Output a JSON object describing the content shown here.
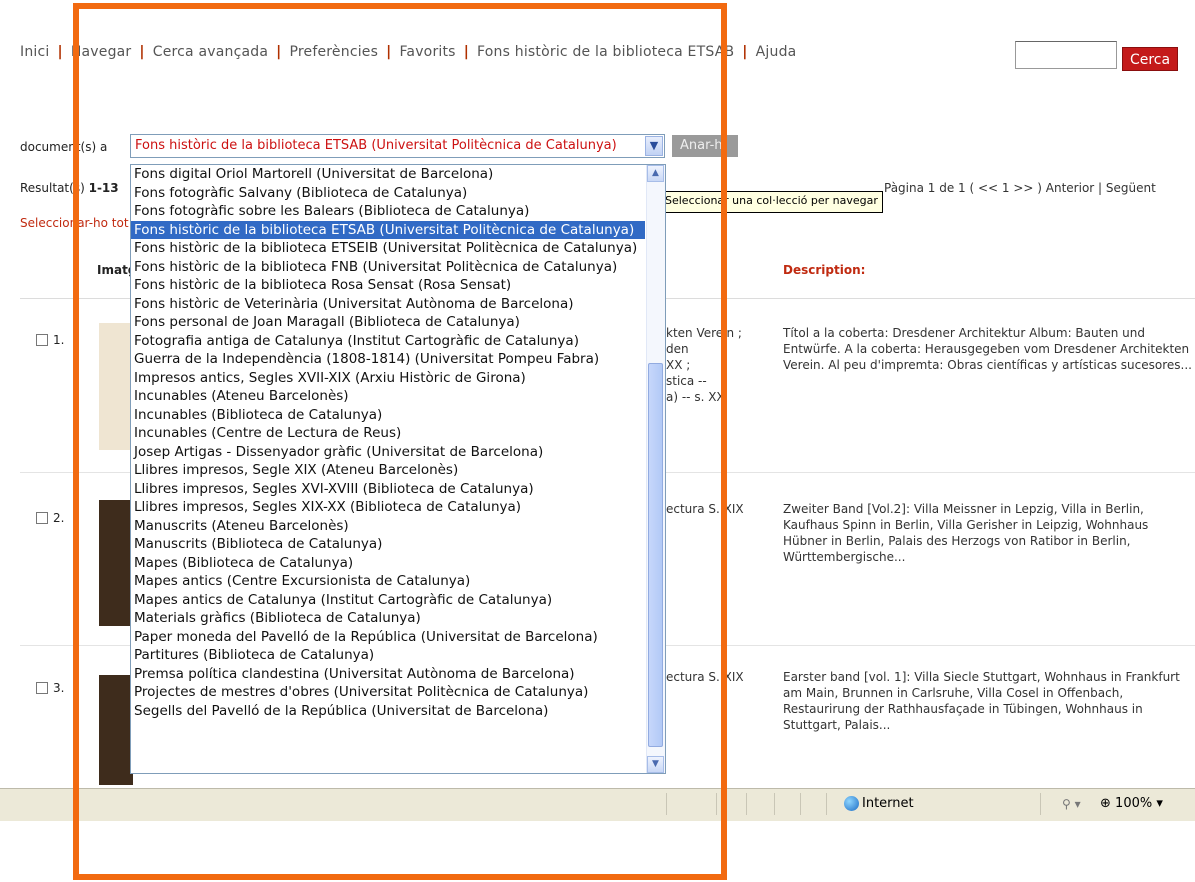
{
  "nav": {
    "links": [
      "Inici",
      "Navegar",
      "Cerca avançada",
      "Preferències",
      "Favorits",
      "Fons històric de la biblioteca ETSAB",
      "Ajuda"
    ],
    "separator": "|",
    "search_button": "Cerca"
  },
  "browse": {
    "label": "document(s) a",
    "selected": "Fons històric de la biblioteca ETSAB (Universitat Politècnica de Catalunya)",
    "go_button": "Anar-hi",
    "tooltip": "Seleccionar una col·lecció per navegar",
    "dropdown_arrow": "chevron-down-icon"
  },
  "results": {
    "label_prefix": "Resultat(s)",
    "label_range": "1-13",
    "pagination": "Pàgina 1 de 1 ( << 1 >> ) Anterior | Següent",
    "select_all": "Seleccionar-ho tot"
  },
  "table": {
    "header_image": "Imatge",
    "header_description": "Description:",
    "rows": [
      {
        "num": "1.",
        "mid": [
          "kten Verein ;",
          "den",
          "XX ;",
          "stica --",
          "a) -- s. XX"
        ],
        "desc": "Títol a la coberta: Dresdener Architektur Album: Bauten und Entwürfe. A la coberta: Herausgegeben vom Dresdener Architekten Verein. Al peu d'impremta: Obras científicas y artísticas sucesores..."
      },
      {
        "num": "2.",
        "mid": [
          "ectura S. XIX"
        ],
        "desc": "Zweiter Band [Vol.2]: Villa Meissner in Lepzig, Villa in Berlin, Kaufhaus Spinn in Berlin, Villa Gerisher in Leipzig, Wohnhaus Hübner in Berlin, Palais des Herzogs von Ratibor in Berlin, Württembergische..."
      },
      {
        "num": "3.",
        "mid": [
          "ectura S. XIX"
        ],
        "desc": "Earster band [vol. 1]: Villa Siecle Stuttgart, Wohnhaus in Frankfurt am Main, Brunnen in Carlsruhe, Villa Cosel in Offenbach, Restaurirung der Rathhausfaçade in Tübingen, Wohnhaus in Stuttgart, Palais..."
      }
    ]
  },
  "dropdown": {
    "selected_index": 3,
    "options": [
      "Fons digital Oriol Martorell (Universitat de Barcelona)",
      "Fons fotogràfic Salvany (Biblioteca de Catalunya)",
      "Fons fotogràfic sobre les Balears (Biblioteca de Catalunya)",
      "Fons històric de la biblioteca ETSAB (Universitat Politècnica de Catalunya)",
      "Fons històric de la biblioteca ETSEIB (Universitat Politècnica de Catalunya)",
      "Fons històric de la biblioteca FNB (Universitat Politècnica de Catalunya)",
      "Fons històric de la biblioteca Rosa Sensat (Rosa Sensat)",
      "Fons històric de Veterinària (Universitat Autònoma de Barcelona)",
      "Fons personal de Joan Maragall (Biblioteca de Catalunya)",
      "Fotografia antiga de Catalunya (Institut Cartogràfic de Catalunya)",
      "Guerra de la Independència (1808-1814) (Universitat Pompeu Fabra)",
      "Impresos antics, Segles XVII-XIX (Arxiu Històric de Girona)",
      "Incunables (Ateneu Barcelonès)",
      "Incunables (Biblioteca de Catalunya)",
      "Incunables (Centre de Lectura de Reus)",
      "Josep Artigas - Dissenyador gràfic (Universitat de Barcelona)",
      "Llibres impresos, Segle XIX (Ateneu Barcelonès)",
      "Llibres impresos, Segles XVI-XVIII (Biblioteca de Catalunya)",
      "Llibres impresos, Segles XIX-XX (Biblioteca de Catalunya)",
      "Manuscrits (Ateneu Barcelonès)",
      "Manuscrits (Biblioteca de Catalunya)",
      "Mapes (Biblioteca de Catalunya)",
      "Mapes antics (Centre Excursionista de Catalunya)",
      "Mapes antics de Catalunya (Institut Cartogràfic de Catalunya)",
      "Materials gràfics (Biblioteca de Catalunya)",
      "Paper moneda del Pavelló de la República (Universitat de Barcelona)",
      "Partitures (Biblioteca de Catalunya)",
      "Premsa política clandestina (Universitat Autònoma de Barcelona)",
      "Projectes de mestres d'obres (Universitat Politècnica de Catalunya)",
      "Segells del Pavelló de la República (Universitat de Barcelona)"
    ]
  },
  "statusbar": {
    "zone": "Internet",
    "zoom": "100%"
  },
  "colors": {
    "annotation_frame": "#f26a10",
    "search_button": "#c41a1a",
    "selected_option": "#316ac5",
    "selected_value_text": "#cc1111"
  }
}
